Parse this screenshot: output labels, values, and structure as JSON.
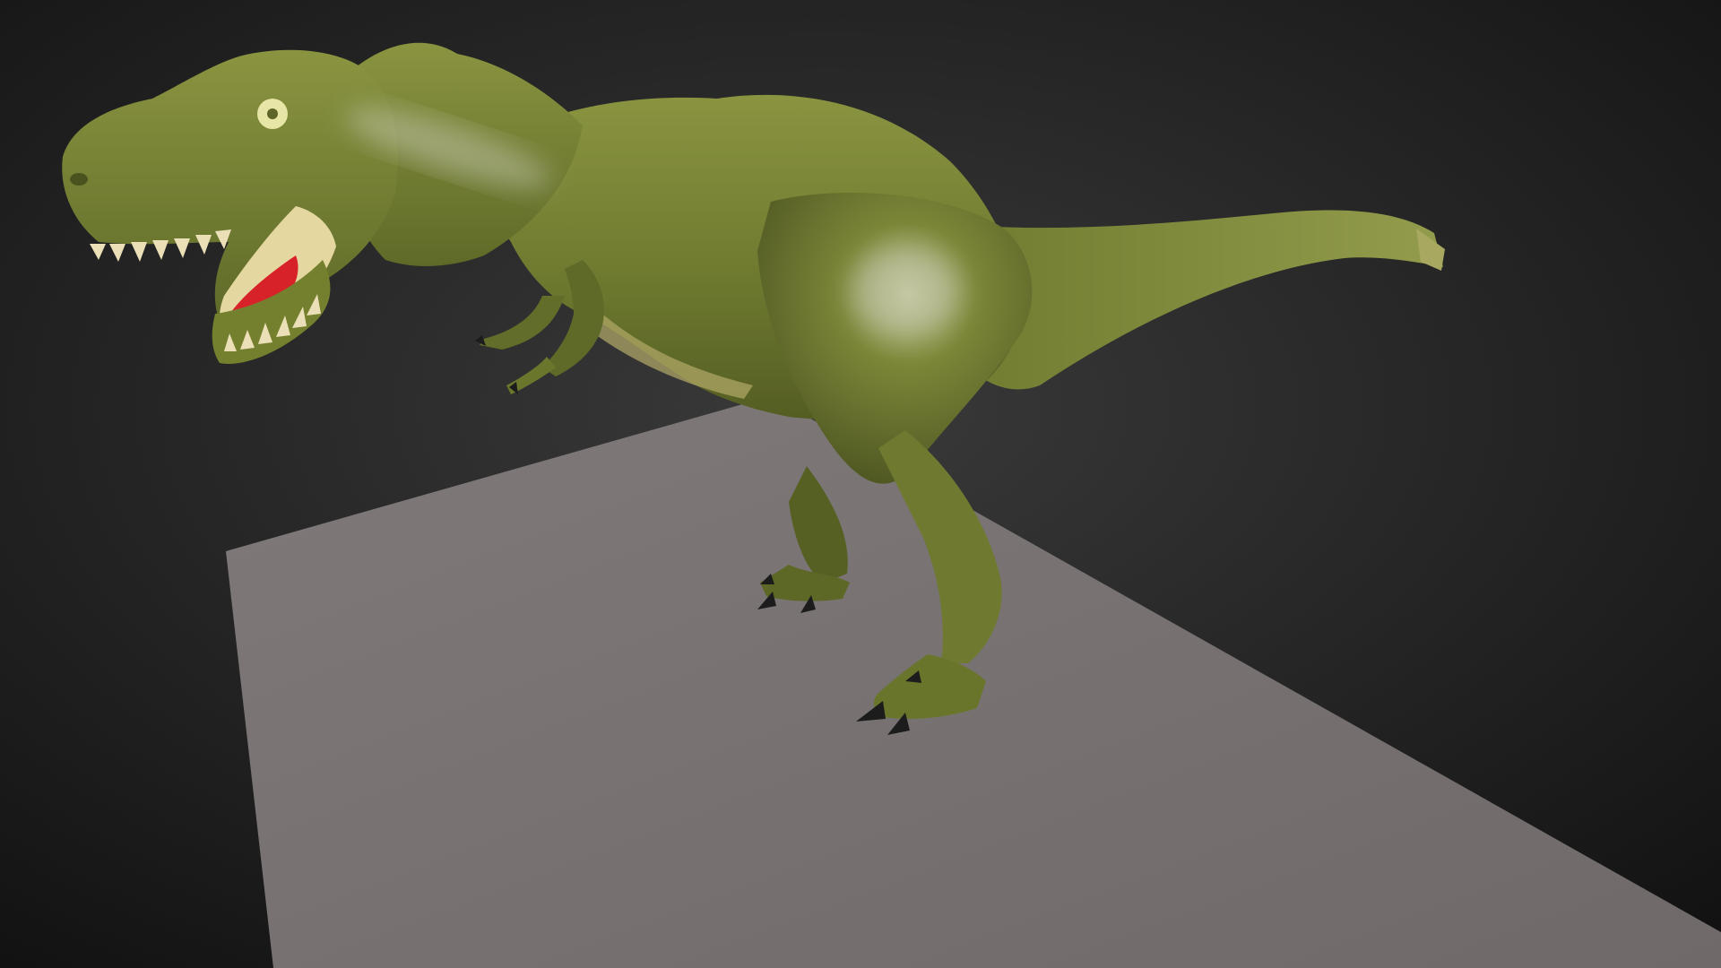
{
  "scene": {
    "background": {
      "inner": "#3a3a3a",
      "outer": "#121212"
    },
    "ground_plane": {
      "color": "#7a7474",
      "shadow": "#6b6565"
    },
    "model": {
      "subject": "t-rex-icon",
      "skin": "#7d8a3a",
      "skin_dark": "#4e5620",
      "skin_light": "#a6ad62",
      "belly": "#b3ab6a",
      "mouth_inner": "#e4d8a0",
      "tongue": "#d8222a",
      "teeth": "#eadfb6",
      "eye": "#e8e6a6",
      "claws": "#1c1c1c"
    }
  }
}
